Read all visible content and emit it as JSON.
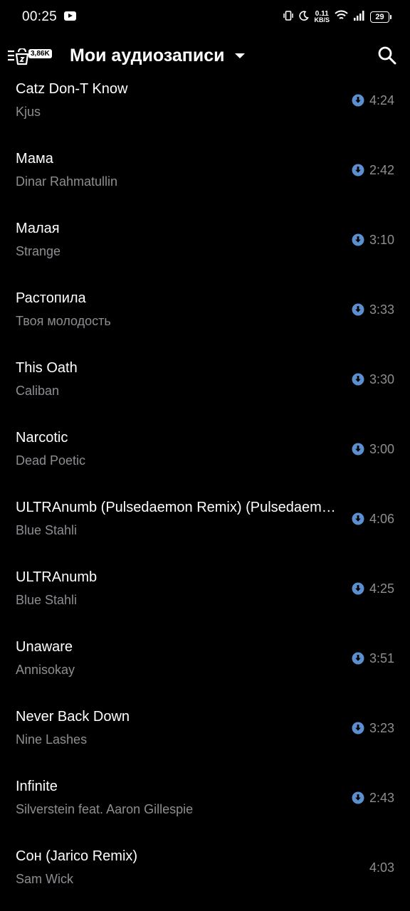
{
  "status_bar": {
    "time": "00:25",
    "net_speed_value": "0.11",
    "net_speed_unit": "KB/S",
    "battery": "29",
    "icons": [
      "youtube-icon",
      "vibrate-icon",
      "moon-icon",
      "wifi-icon",
      "signal-icon"
    ]
  },
  "toolbar": {
    "badge": "3,86K",
    "title": "Мои аудиозаписи"
  },
  "colors": {
    "background": "#000000",
    "primary_text": "#ffffff",
    "secondary_text": "#8d8e92",
    "accent": "#5b8fd0"
  },
  "tracks": [
    {
      "title": "Catz Don-T Know",
      "artist": "Kjus",
      "duration": "4:24",
      "downloaded": true
    },
    {
      "title": "Мама",
      "artist": "Dinar Rahmatullin",
      "duration": "2:42",
      "downloaded": true
    },
    {
      "title": "Малая",
      "artist": "Strange",
      "duration": "3:10",
      "downloaded": true
    },
    {
      "title": "Растопила",
      "artist": "Твоя молодость",
      "duration": "3:33",
      "downloaded": true
    },
    {
      "title": "This Oath",
      "artist": "Caliban",
      "duration": "3:30",
      "downloaded": true
    },
    {
      "title": "Narcotic",
      "artist": "Dead Poetic",
      "duration": "3:00",
      "downloaded": true
    },
    {
      "title": "ULTRAnumb (Pulsedaemon Remix) (Pulsedaemon Remix)",
      "artist": "Blue Stahli",
      "duration": "4:06",
      "downloaded": true
    },
    {
      "title": "ULTRAnumb",
      "artist": "Blue Stahli",
      "duration": "4:25",
      "downloaded": true
    },
    {
      "title": "Unaware",
      "artist": "Annisokay",
      "duration": "3:51",
      "downloaded": true
    },
    {
      "title": "Never Back Down",
      "artist": "Nine Lashes",
      "duration": "3:23",
      "downloaded": true
    },
    {
      "title": "Infinite",
      "artist": "Silverstein feat. Aaron Gillespie",
      "duration": "2:43",
      "downloaded": true
    },
    {
      "title": "Сон (Jarico Remix)",
      "artist": "Sam Wick",
      "duration": "4:03",
      "downloaded": false
    }
  ]
}
